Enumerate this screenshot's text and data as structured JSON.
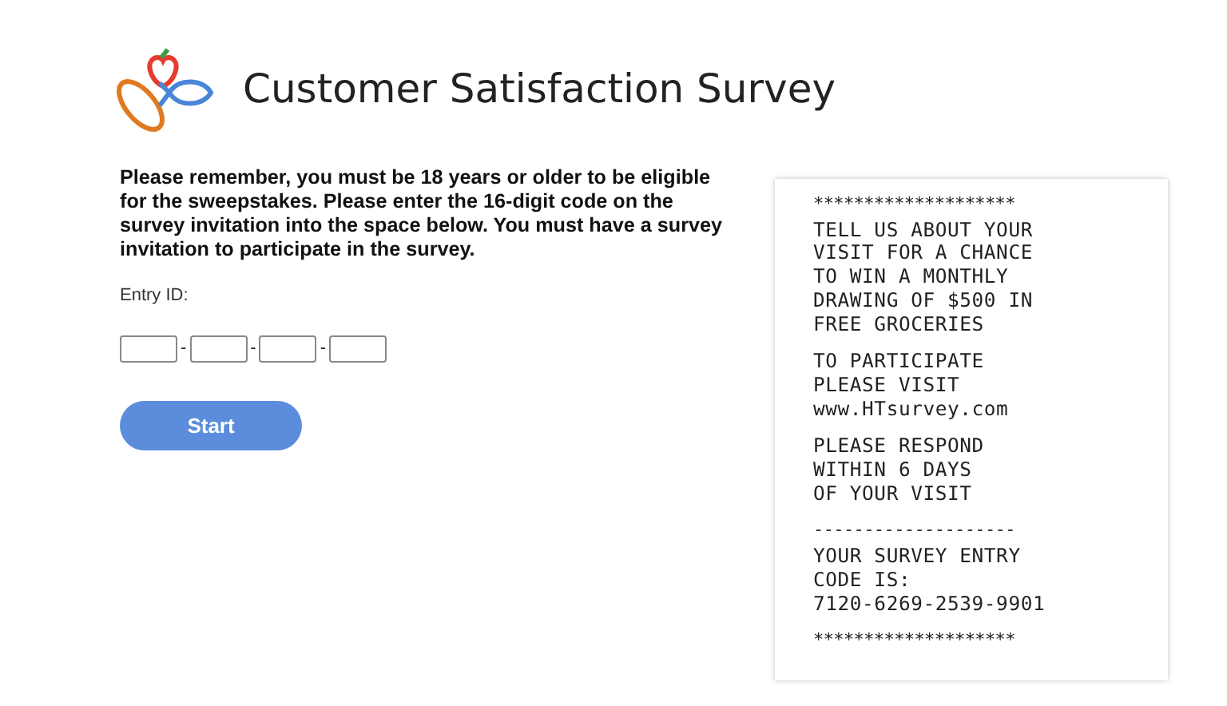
{
  "header": {
    "title": "Customer Satisfaction Survey"
  },
  "form": {
    "instructions": "Please remember, you must be 18 years or older to be eligible for the sweepstakes. Please enter the 16-digit code on the survey invitation into the space below. You must have a survey invitation to participate in the survey.",
    "entry_label": "Entry ID:",
    "separators": [
      "-",
      "-",
      "-"
    ],
    "entry_fields": [
      {
        "kind": "text"
      },
      {
        "kind": "text"
      },
      {
        "kind": "text"
      },
      {
        "kind": "text"
      }
    ],
    "start_button": "Start"
  },
  "receipt": {
    "blocks": [
      {
        "kind": "rule",
        "lines": [
          "********************"
        ]
      },
      {
        "kind": "text",
        "lines": [
          "TELL US ABOUT YOUR",
          "VISIT FOR A CHANCE",
          "TO WIN A MONTHLY",
          "DRAWING OF $500 IN",
          "FREE GROCERIES"
        ]
      },
      {
        "kind": "text",
        "lines": [
          "TO PARTICIPATE",
          "PLEASE VISIT",
          "www.HTsurvey.com"
        ]
      },
      {
        "kind": "text",
        "lines": [
          "PLEASE RESPOND",
          "WITHIN 6 DAYS",
          "OF YOUR VISIT"
        ]
      },
      {
        "kind": "rule",
        "lines": [
          "--------------------"
        ]
      },
      {
        "kind": "text",
        "lines": [
          "YOUR SURVEY ENTRY",
          "CODE IS:",
          "7120-6269-2539-9901"
        ]
      },
      {
        "kind": "rule",
        "lines": [
          "********************"
        ]
      }
    ]
  }
}
